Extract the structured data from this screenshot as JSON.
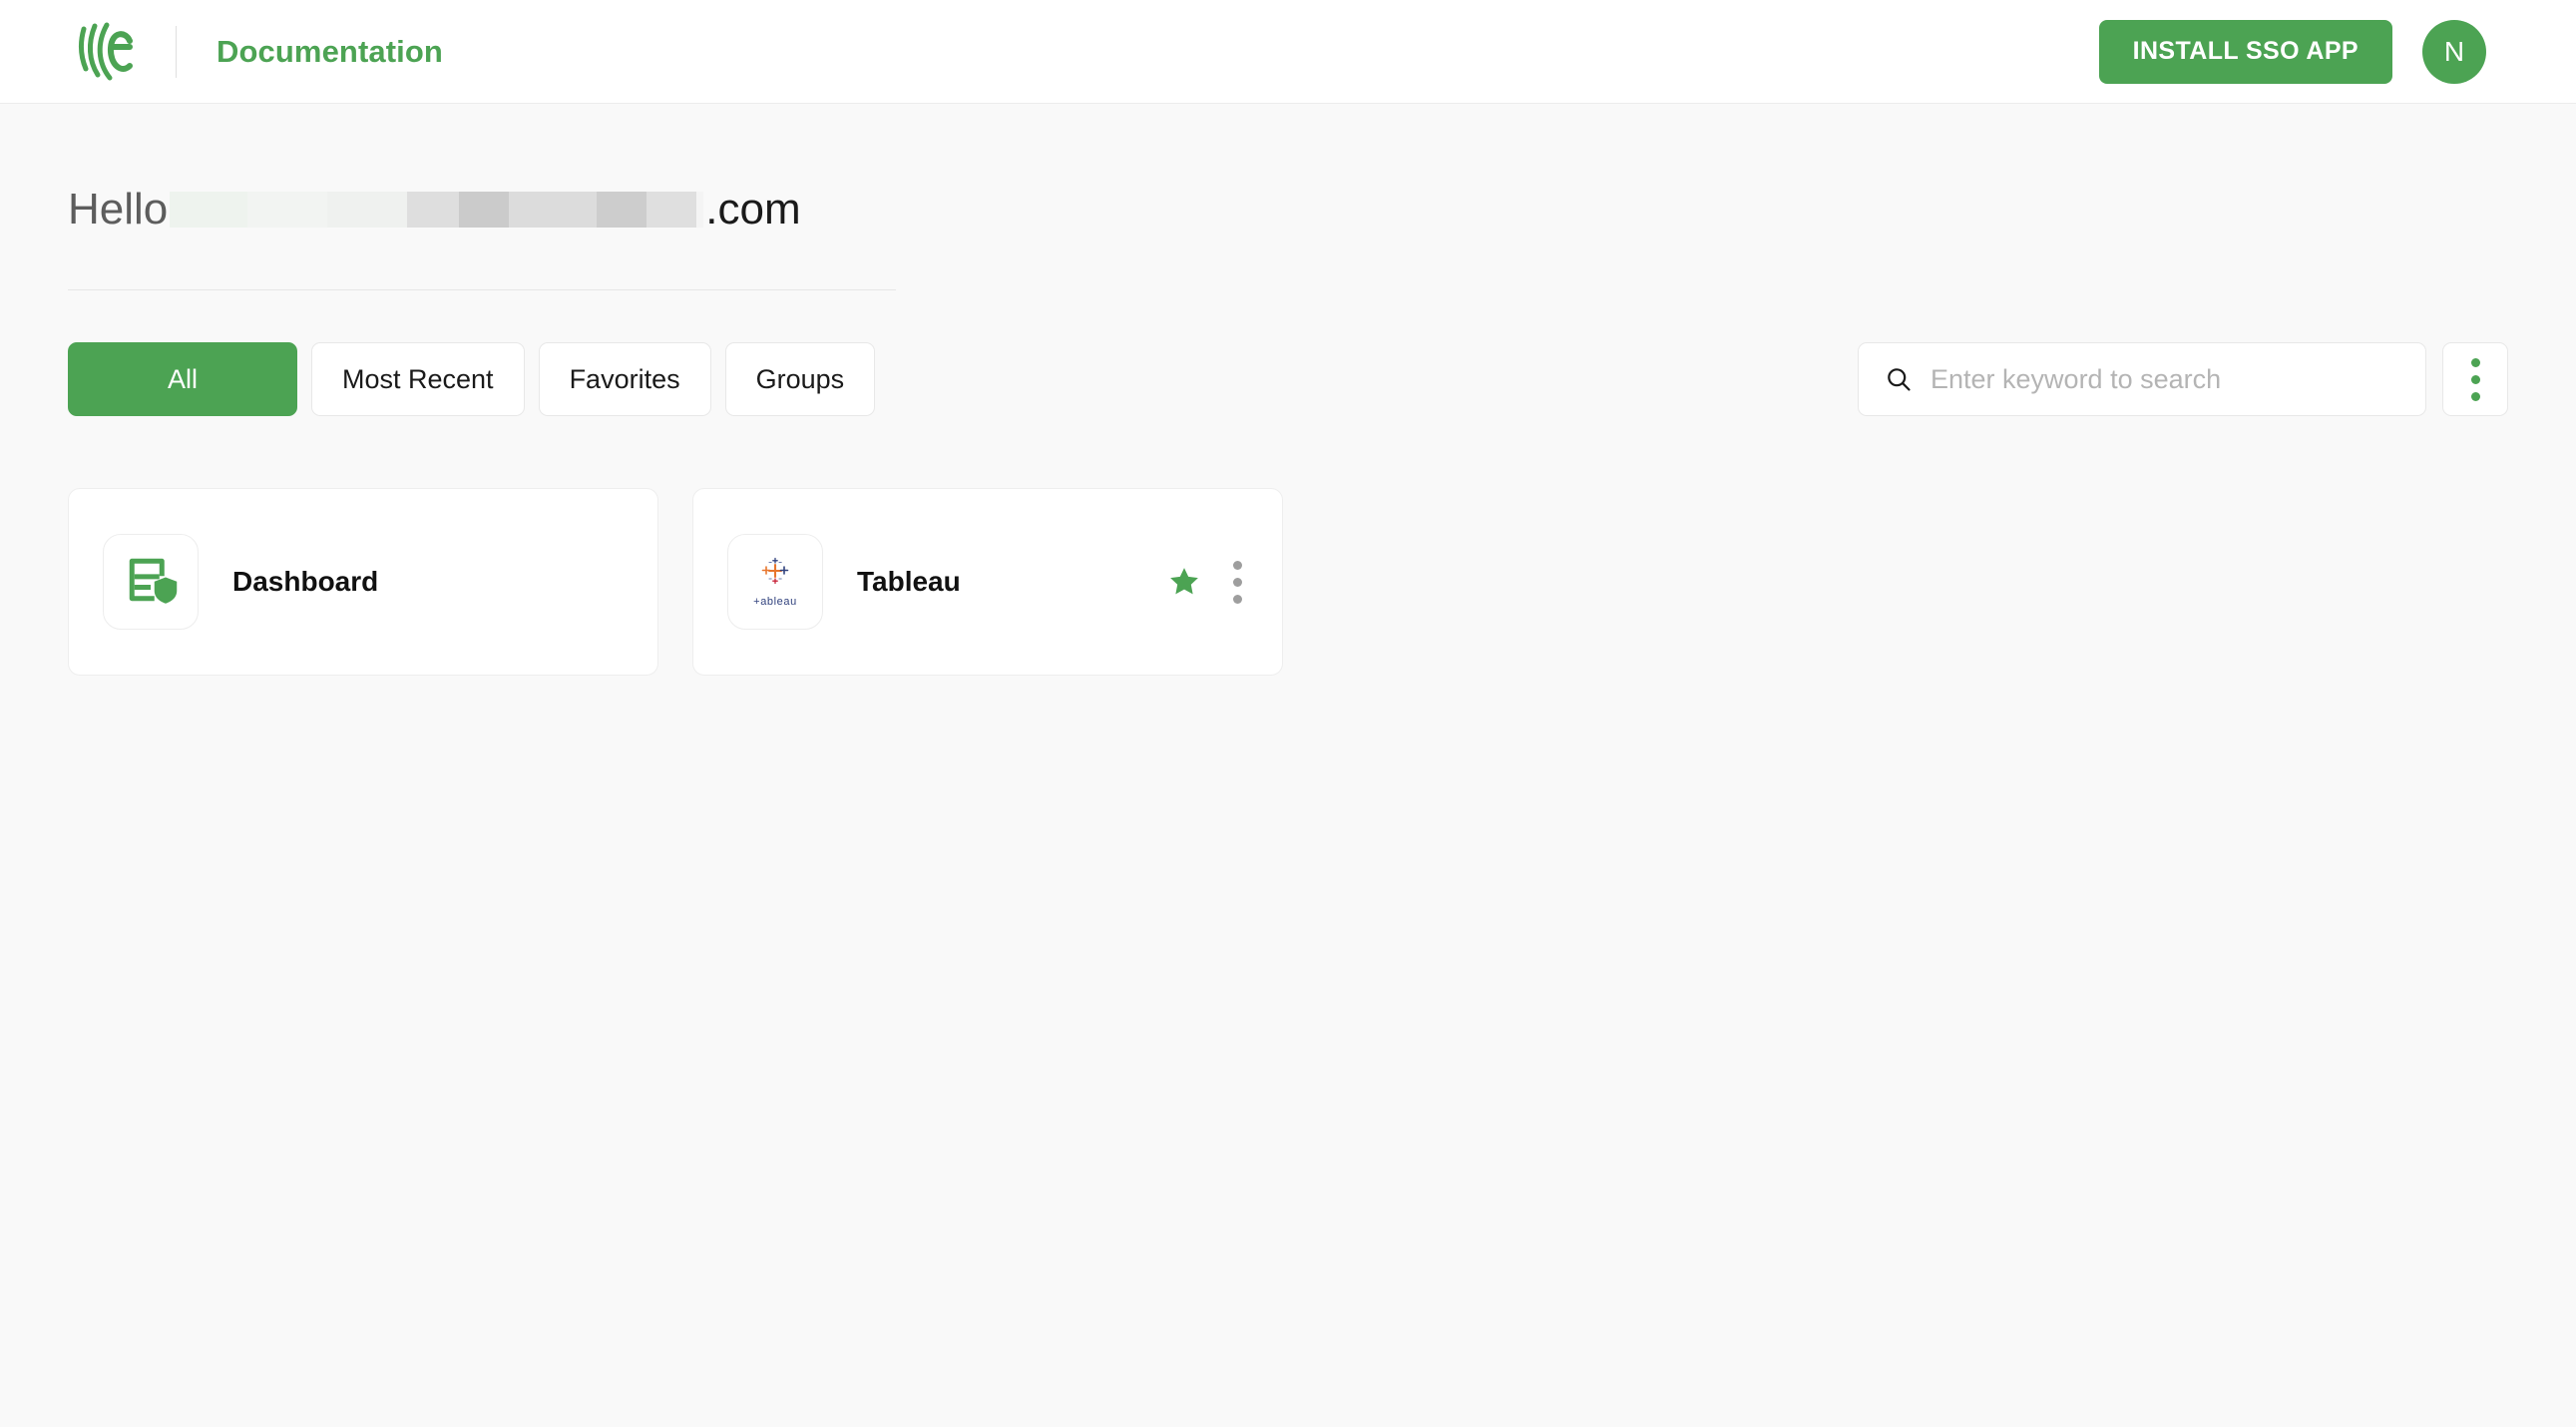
{
  "header": {
    "logo_icon": "ekran-logo-icon",
    "title": "Documentation",
    "install_button": "INSTALL SSO APP",
    "avatar_initial": "N"
  },
  "greeting": {
    "hello_label": "Hello",
    "redacted_name": "",
    "domain_suffix": ".com"
  },
  "filters": {
    "tabs": [
      {
        "label": "All",
        "active": true
      },
      {
        "label": "Most Recent",
        "active": false
      },
      {
        "label": "Favorites",
        "active": false
      },
      {
        "label": "Groups",
        "active": false
      }
    ]
  },
  "search": {
    "placeholder": "Enter keyword to search",
    "value": "",
    "icon": "search-icon",
    "overflow_icon": "vertical-dots-icon"
  },
  "apps": [
    {
      "name": "Dashboard",
      "icon": "document-shield-icon",
      "favorite": false,
      "has_menu": false
    },
    {
      "name": "Tableau",
      "icon": "tableau-logo-icon",
      "wordmark": "+ableau",
      "favorite": true,
      "has_menu": true
    }
  ],
  "colors": {
    "brand_green": "#4ca353",
    "page_background": "#f9f9f9",
    "card_background": "#ffffff",
    "star_green": "#4ca353",
    "kebab_gray": "#9e9e9e",
    "tableau_navy": "#31427e",
    "tableau_orange": "#e8762d",
    "tableau_red": "#c72037"
  }
}
